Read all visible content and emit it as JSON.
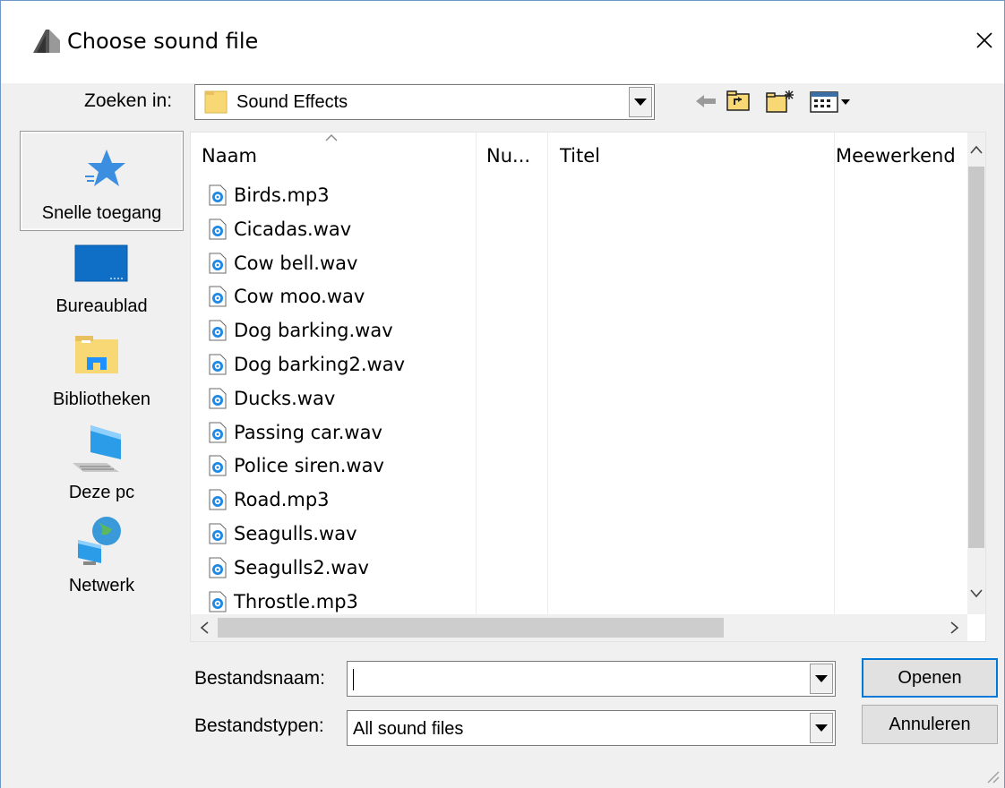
{
  "window": {
    "title": "Choose sound file",
    "close_symbol": "✕"
  },
  "lookin": {
    "label": "Zoeken in:",
    "value": "Sound Effects"
  },
  "places": [
    {
      "label": "Snelle toegang",
      "icon": "quick-access-star-icon"
    },
    {
      "label": "Bureaublad",
      "icon": "desktop-icon"
    },
    {
      "label": "Bibliotheken",
      "icon": "libraries-icon"
    },
    {
      "label": "Deze pc",
      "icon": "this-pc-icon"
    },
    {
      "label": "Netwerk",
      "icon": "network-icon"
    }
  ],
  "columns": {
    "name": "Naam",
    "number": "Nu...",
    "title": "Titel",
    "contributing": "Meewerkend"
  },
  "files": [
    "Birds.mp3",
    "Cicadas.wav",
    "Cow bell.wav",
    "Cow moo.wav",
    "Dog barking.wav",
    "Dog barking2.wav",
    "Ducks.wav",
    "Passing car.wav",
    "Police siren.wav",
    "Road.mp3",
    "Seagulls.wav",
    "Seagulls2.wav",
    "Throstle.mp3"
  ],
  "filename": {
    "label": "Bestandsnaam:",
    "value": ""
  },
  "filetype": {
    "label": "Bestandstypen:",
    "value": "All sound files"
  },
  "buttons": {
    "open": "Openen",
    "cancel": "Annuleren"
  },
  "colors": {
    "accent": "#0078d7",
    "folder": "#f8d775",
    "desktop": "#0f6fc6"
  }
}
